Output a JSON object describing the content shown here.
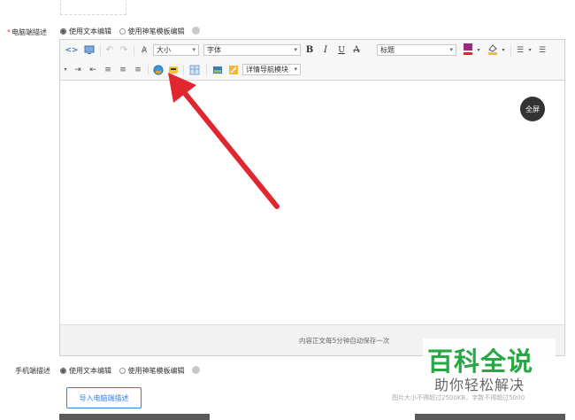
{
  "pc_desc": {
    "required_mark": "*",
    "label": "电脑端描述",
    "options": [
      "使用文本编辑",
      "使用神笔模板编辑"
    ],
    "selected": 0
  },
  "toolbar": {
    "font_size": "大小",
    "font_family": "字体",
    "bold": "B",
    "italic": "I",
    "underline": "U",
    "strike": "A",
    "heading": "标题",
    "detail_nav": "详情导航模块"
  },
  "editor": {
    "fullscreen": "全屏",
    "autosave": "内容正文每5分钟自动保存一次"
  },
  "mobile_desc": {
    "label": "手机端描述",
    "options": [
      "使用文本编辑",
      "使用神笔模板编辑"
    ],
    "selected": 0,
    "import_button": "导入电脑端描述",
    "hint": "图片大小不得超过2500KB，字数不得超过5000"
  },
  "watermark": {
    "title": "百科全说",
    "subtitle": "助你轻松解决"
  },
  "colors": {
    "arrow": "#e0262f",
    "primary_blue": "#3a7fd5",
    "watermark_green": "#28a745"
  }
}
